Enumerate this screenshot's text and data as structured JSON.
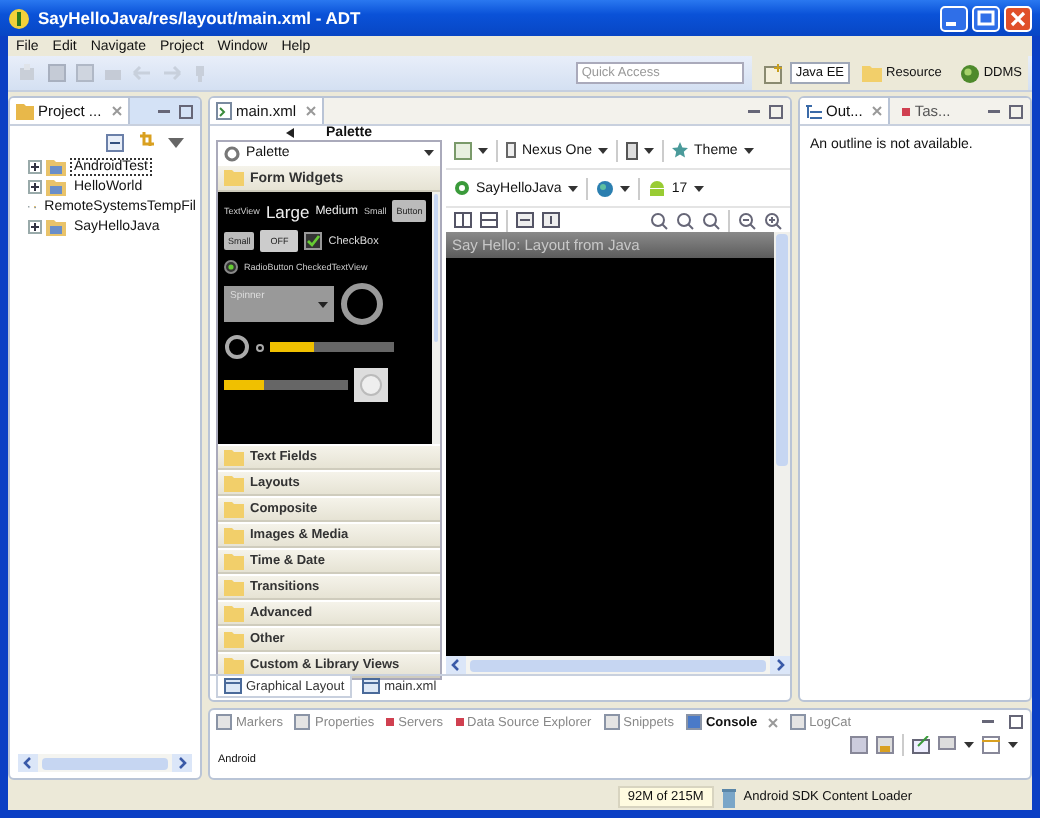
{
  "window": {
    "title": "SayHelloJava/res/layout/main.xml - ADT"
  },
  "menu": [
    "File",
    "Edit",
    "Navigate",
    "Project",
    "Window",
    "Help"
  ],
  "quick_access": {
    "placeholder": "Quick Access"
  },
  "perspectives": [
    {
      "label": "Java EE",
      "selected": true
    },
    {
      "label": "Resource",
      "selected": false
    },
    {
      "label": "DDMS",
      "selected": false
    }
  ],
  "project_explorer": {
    "tab": "Project ...",
    "items": [
      {
        "label": "AndroidTest",
        "selected": true
      },
      {
        "label": "HelloWorld",
        "selected": false
      },
      {
        "label": "RemoteSystemsTempFil",
        "selected": false
      },
      {
        "label": "SayHelloJava",
        "selected": false
      }
    ]
  },
  "editor": {
    "tab": "main.xml",
    "palette": {
      "title": "Palette",
      "dropdown": "Palette",
      "open_category": "Form Widgets",
      "preview": {
        "textview": "TextView",
        "large": "Large",
        "medium": "Medium",
        "small": "Small",
        "button": "Button",
        "small_button": "Small",
        "toggle": "OFF",
        "checkbox": {
          "label": "CheckBox",
          "checked": true
        },
        "radio": "RadioButton",
        "checked_text": "CheckedTextView",
        "spinner": "Spinner",
        "progress": {
          "level": 0.35
        },
        "seekbar": {
          "level": 0.33
        }
      },
      "categories": [
        "Text Fields",
        "Layouts",
        "Composite",
        "Images & Media",
        "Time & Date",
        "Transitions",
        "Advanced",
        "Other",
        "Custom & Library Views"
      ]
    },
    "canvas": {
      "device": "Nexus One",
      "theme": "Theme",
      "activity": "SayHelloJava",
      "api": "17",
      "app_title": "Say Hello: Layout from Java"
    },
    "bottom_tabs": [
      {
        "label": "Graphical Layout",
        "selected": true
      },
      {
        "label": "main.xml",
        "selected": false
      }
    ]
  },
  "outline": {
    "tabs": [
      {
        "label": "Out...",
        "selected": true
      },
      {
        "label": "Tas...",
        "selected": false
      }
    ],
    "message": "An outline is not available."
  },
  "bottom_panel": {
    "tabs": [
      {
        "label": "Markers",
        "selected": false
      },
      {
        "label": "Properties",
        "selected": false
      },
      {
        "label": "Servers",
        "selected": false
      },
      {
        "label": "Data Source Explorer",
        "selected": false
      },
      {
        "label": "Snippets",
        "selected": false
      },
      {
        "label": "Console",
        "selected": true
      },
      {
        "label": "LogCat",
        "selected": false
      }
    ],
    "content": "Android"
  },
  "status_bar": {
    "memory": "92M of 215M",
    "task": "Android SDK Content Loader"
  }
}
